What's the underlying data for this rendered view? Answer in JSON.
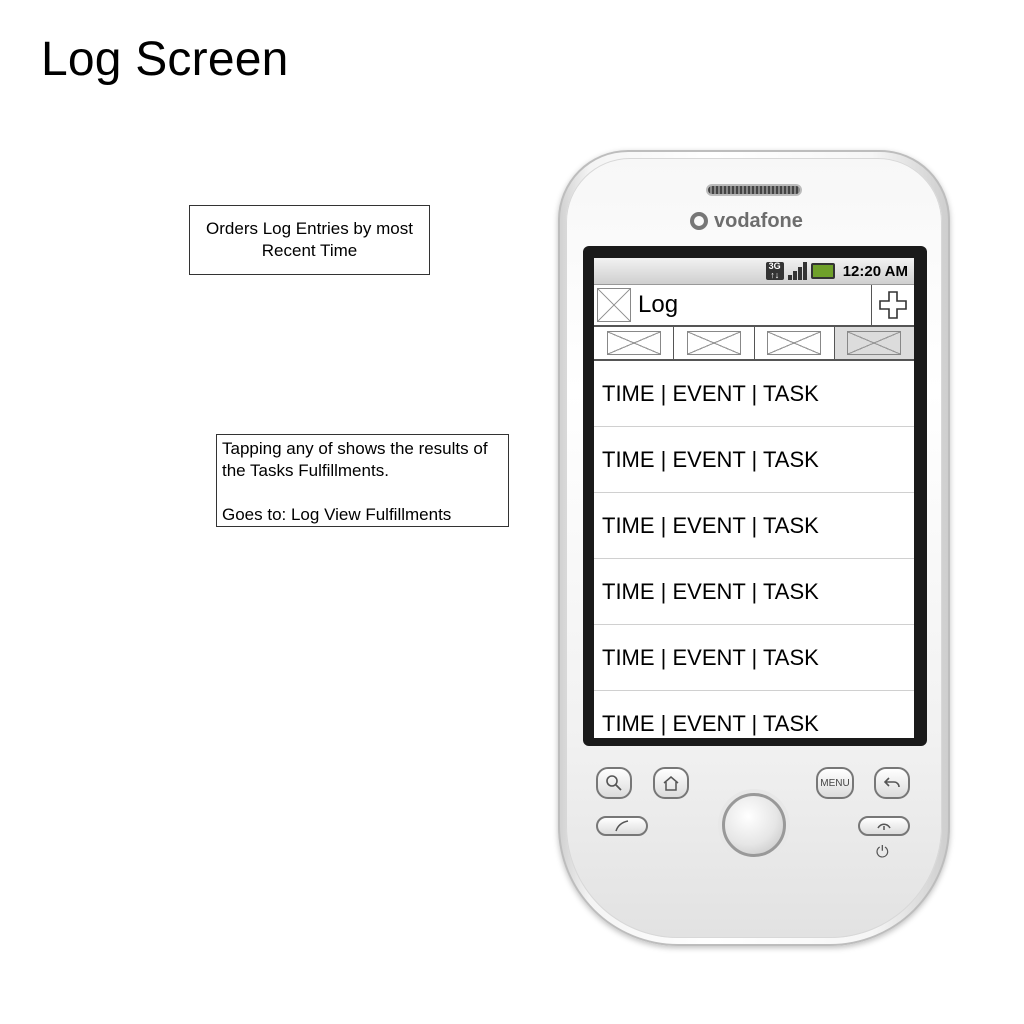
{
  "page_title": "Log Screen",
  "annotations": {
    "note1": "Orders Log Entries by most Recent Time",
    "note2_line1": "Tapping any of shows the results of the Tasks Fulfillments.",
    "note2_line2": "Goes to: Log View Fulfillments"
  },
  "device": {
    "brand": "vodafone",
    "hardware_buttons": [
      "search-icon",
      "home-icon",
      "menu",
      "back-icon",
      "call-icon",
      "end-call-icon",
      "power-icon"
    ],
    "menu_label": "MENU"
  },
  "status_bar": {
    "time": "12:20 AM",
    "network": "3G",
    "icons": [
      "3g-icon",
      "signal-icon",
      "battery-icon"
    ]
  },
  "app": {
    "title": "Log",
    "add_icon": "plus-icon",
    "tabs": [
      "image-placeholder",
      "image-placeholder",
      "image-placeholder",
      "image-placeholder"
    ],
    "selected_tab": 4
  },
  "log_entries": [
    "TIME | EVENT | TASK",
    "TIME | EVENT | TASK",
    "TIME | EVENT | TASK",
    "TIME | EVENT | TASK",
    "TIME | EVENT | TASK",
    "TIME | EVENT | TASK"
  ]
}
